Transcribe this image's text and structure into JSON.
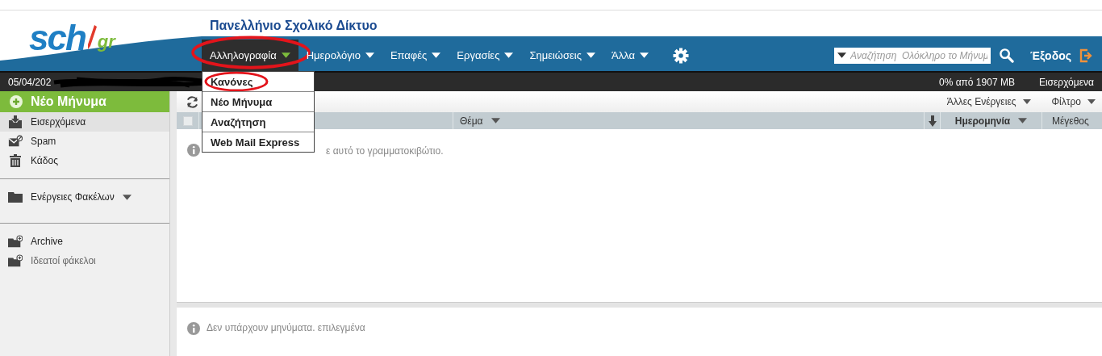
{
  "logo": {
    "name": "sch",
    "domain": "gr"
  },
  "site_title": "Πανελλήνιο Σχολικό Δίκτυο",
  "nav": [
    {
      "label": "Αλληλογραφία",
      "selected": true,
      "highlighted": true
    },
    {
      "label": "Ημερολόγιο",
      "selected": false,
      "highlighted": false
    },
    {
      "label": "Επαφές",
      "selected": false,
      "highlighted": false
    },
    {
      "label": "Εργασίες",
      "selected": false,
      "highlighted": false
    },
    {
      "label": "Σημειώσεις",
      "selected": false,
      "highlighted": false
    },
    {
      "label": "Άλλα",
      "selected": false,
      "highlighted": false
    }
  ],
  "dropdown": [
    {
      "label": "Κανόνες",
      "highlighted": true
    },
    {
      "label": "Νέο Μήνυμα",
      "highlighted": false
    },
    {
      "label": "Αναζήτηση",
      "highlighted": false
    },
    {
      "label": "Web Mail Express",
      "highlighted": false
    }
  ],
  "search": {
    "placeholder": "Αναζήτηση  Ολόκληρο το Μήνυμ"
  },
  "logout": "Έξοδος",
  "status_bar": {
    "date": "05/04/202",
    "redacted": true,
    "quota": "0% από 1907 MB",
    "folder": "Εισερχόμενα"
  },
  "new_message": "Νέο Μήνυμα",
  "folders": [
    {
      "label": "Εισερχόμενα",
      "kind": "inbox",
      "selected": true
    },
    {
      "label": "Spam",
      "kind": "spam",
      "selected": false
    },
    {
      "label": "Κάδος",
      "kind": "trash",
      "selected": false
    }
  ],
  "folder_actions": "Ενέργειες Φακέλων",
  "custom_folders": [
    {
      "label": "Archive",
      "dimmed": false
    },
    {
      "label": "Ιδεατοί φάκελοι",
      "dimmed": true
    }
  ],
  "toolbar": {
    "more_actions": "Άλλες Ενέργειες",
    "filter": "Φίλτρο"
  },
  "select_all": {
    "checked": false
  },
  "columns": [
    {
      "label": "Θέμα",
      "sorted": false,
      "menu": true
    },
    {
      "label": "Ημερομηνία",
      "sorted": true,
      "menu": true
    },
    {
      "label": "Μέγεθος",
      "sorted": false,
      "menu": false
    }
  ],
  "list_message": "ε αυτό το γραμματοκιβώτιο.",
  "preview_message": "Δεν υπάρχουν μηνύματα. επιλεγμένα"
}
